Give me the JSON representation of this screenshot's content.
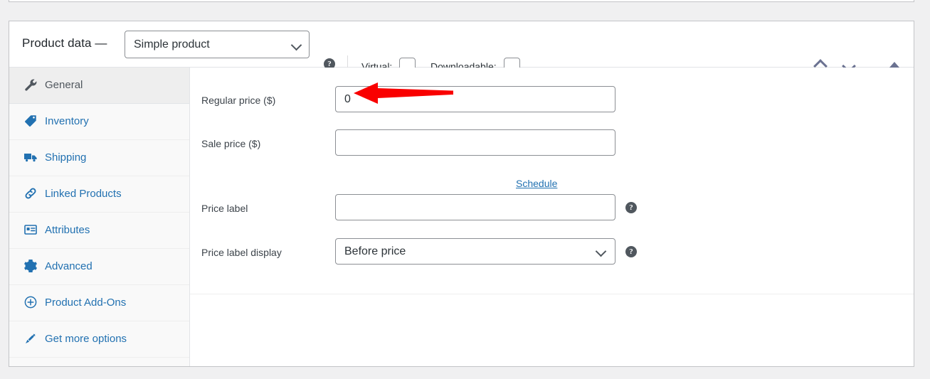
{
  "panel": {
    "title": "Product data —",
    "product_type": {
      "selected": "Simple product",
      "icon": "chevron-down-icon"
    },
    "help_icon": "?",
    "checkboxes": [
      {
        "label": "Virtual:",
        "checked": false
      },
      {
        "label": "Downloadable:",
        "checked": false
      }
    ],
    "controls": {
      "move_up_icon": "chevron-up-icon",
      "move_down_icon": "chevron-down-icon",
      "toggle_icon": "triangle-up-icon"
    }
  },
  "tabs": [
    {
      "label": "General",
      "icon": "wrench-icon",
      "active": true
    },
    {
      "label": "Inventory",
      "icon": "tag-icon",
      "active": false
    },
    {
      "label": "Shipping",
      "icon": "truck-icon",
      "active": false
    },
    {
      "label": "Linked Products",
      "icon": "link-icon",
      "active": false
    },
    {
      "label": "Attributes",
      "icon": "attributes-grid-icon",
      "active": false
    },
    {
      "label": "Advanced",
      "icon": "gear-icon",
      "active": false
    },
    {
      "label": "Product Add-Ons",
      "icon": "plus-circle-icon",
      "active": false
    },
    {
      "label": "Get more options",
      "icon": "plugin-icon",
      "active": false
    }
  ],
  "general_tab": {
    "fields": [
      {
        "label": "Regular price ($)",
        "value": "0",
        "placeholder": "",
        "type": "text",
        "help": false
      },
      {
        "label": "Sale price ($)",
        "value": "",
        "placeholder": "",
        "type": "text",
        "help": false
      },
      {
        "label": "Price label",
        "value": "",
        "placeholder": "",
        "type": "text",
        "help": true
      },
      {
        "label": "Price label display",
        "value": "Before price",
        "placeholder": "",
        "type": "select",
        "help": true
      }
    ],
    "schedule_link": "Schedule",
    "help_icon": "?"
  },
  "annotation": {
    "arrow_color": "#f90000",
    "direction": "left",
    "points_at": "Regular price ($) field value"
  },
  "colors": {
    "background": "#f0f0f1",
    "panel": "#ffffff",
    "border": "#c3c4c7",
    "link": "#2271b1",
    "text": "#3c434a",
    "active_tab_bg": "#eeeeee",
    "sidebar_bg": "#f9f9f9"
  }
}
